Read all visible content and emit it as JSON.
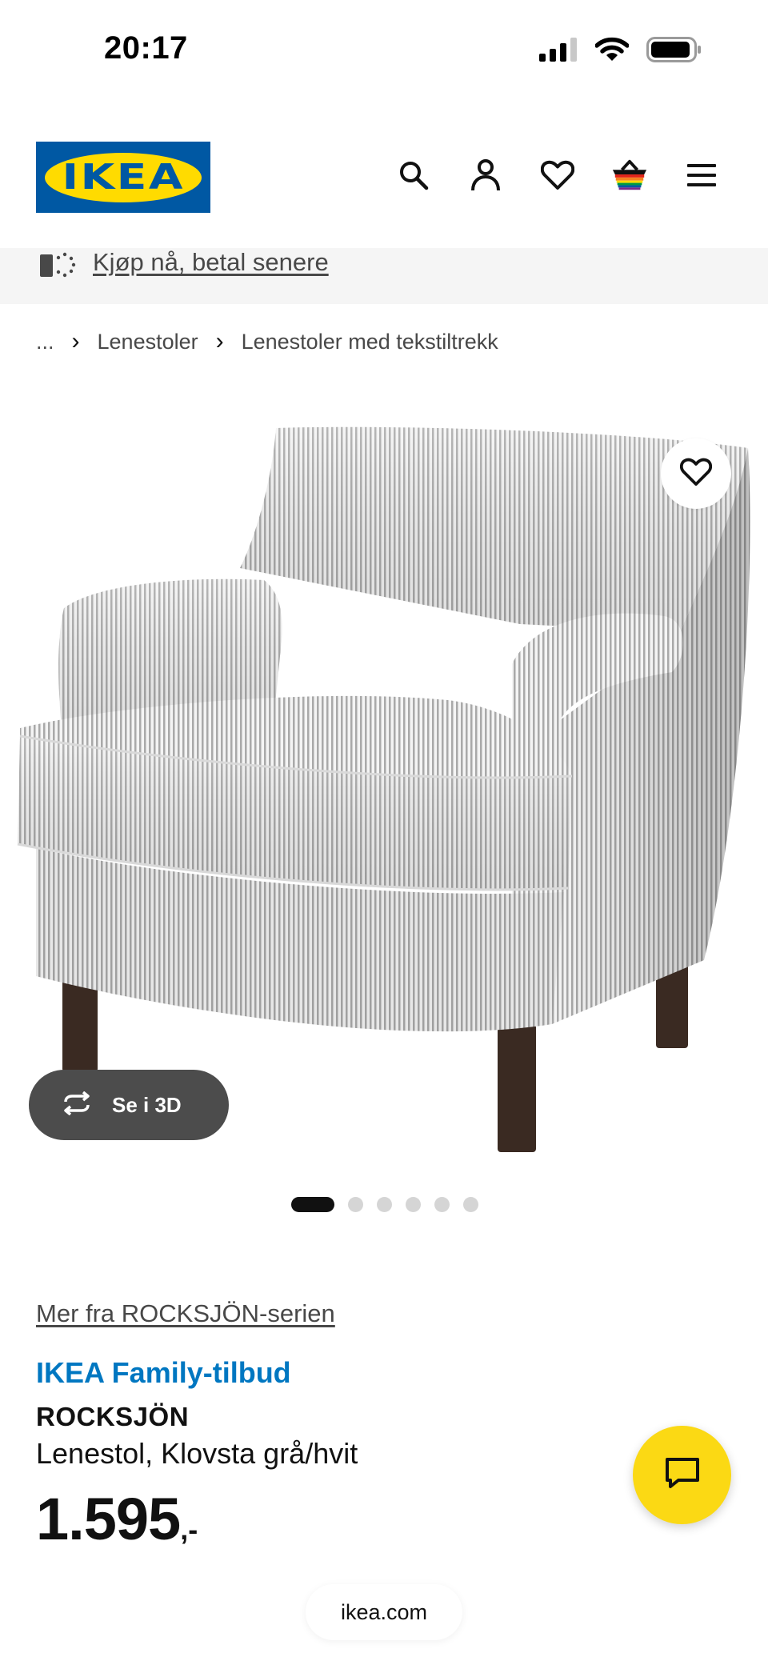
{
  "status_bar": {
    "time": "20:17",
    "icons": [
      "cellular-signal-icon",
      "wifi-icon",
      "battery-icon"
    ]
  },
  "header": {
    "logo_text": "IKEA",
    "logo_reg": "®",
    "icons": [
      "search-icon",
      "user-icon",
      "heart-icon",
      "basket-icon",
      "menu-icon"
    ]
  },
  "promo": {
    "icon": "payment-icon",
    "text": "Kjøp nå, betal senere"
  },
  "breadcrumb": {
    "items": [
      "...",
      "Lenestoler",
      "Lenestoler med tekstiltrekk"
    ],
    "separator": "›"
  },
  "gallery": {
    "three_d_label": "Se i 3D",
    "three_d_icon": "rotate-icon",
    "favorite_icon": "heart-icon",
    "image_count": 6,
    "active_index": 0
  },
  "product": {
    "series_link": "Mer fra ROCKSJÖN-serien",
    "offer_label": "IKEA Family-tilbud",
    "name": "ROCKSJÖN",
    "description": "Lenestol, Klovsta grå/hvit",
    "price": "1.595",
    "price_suffix": ",-"
  },
  "chat": {
    "icon": "chat-icon"
  },
  "browser": {
    "url": "ikea.com"
  },
  "colors": {
    "ikea_blue": "#0058a3",
    "ikea_yellow": "#ffdb00",
    "family_blue": "#0077c1",
    "chat_yellow": "#fbd914"
  }
}
